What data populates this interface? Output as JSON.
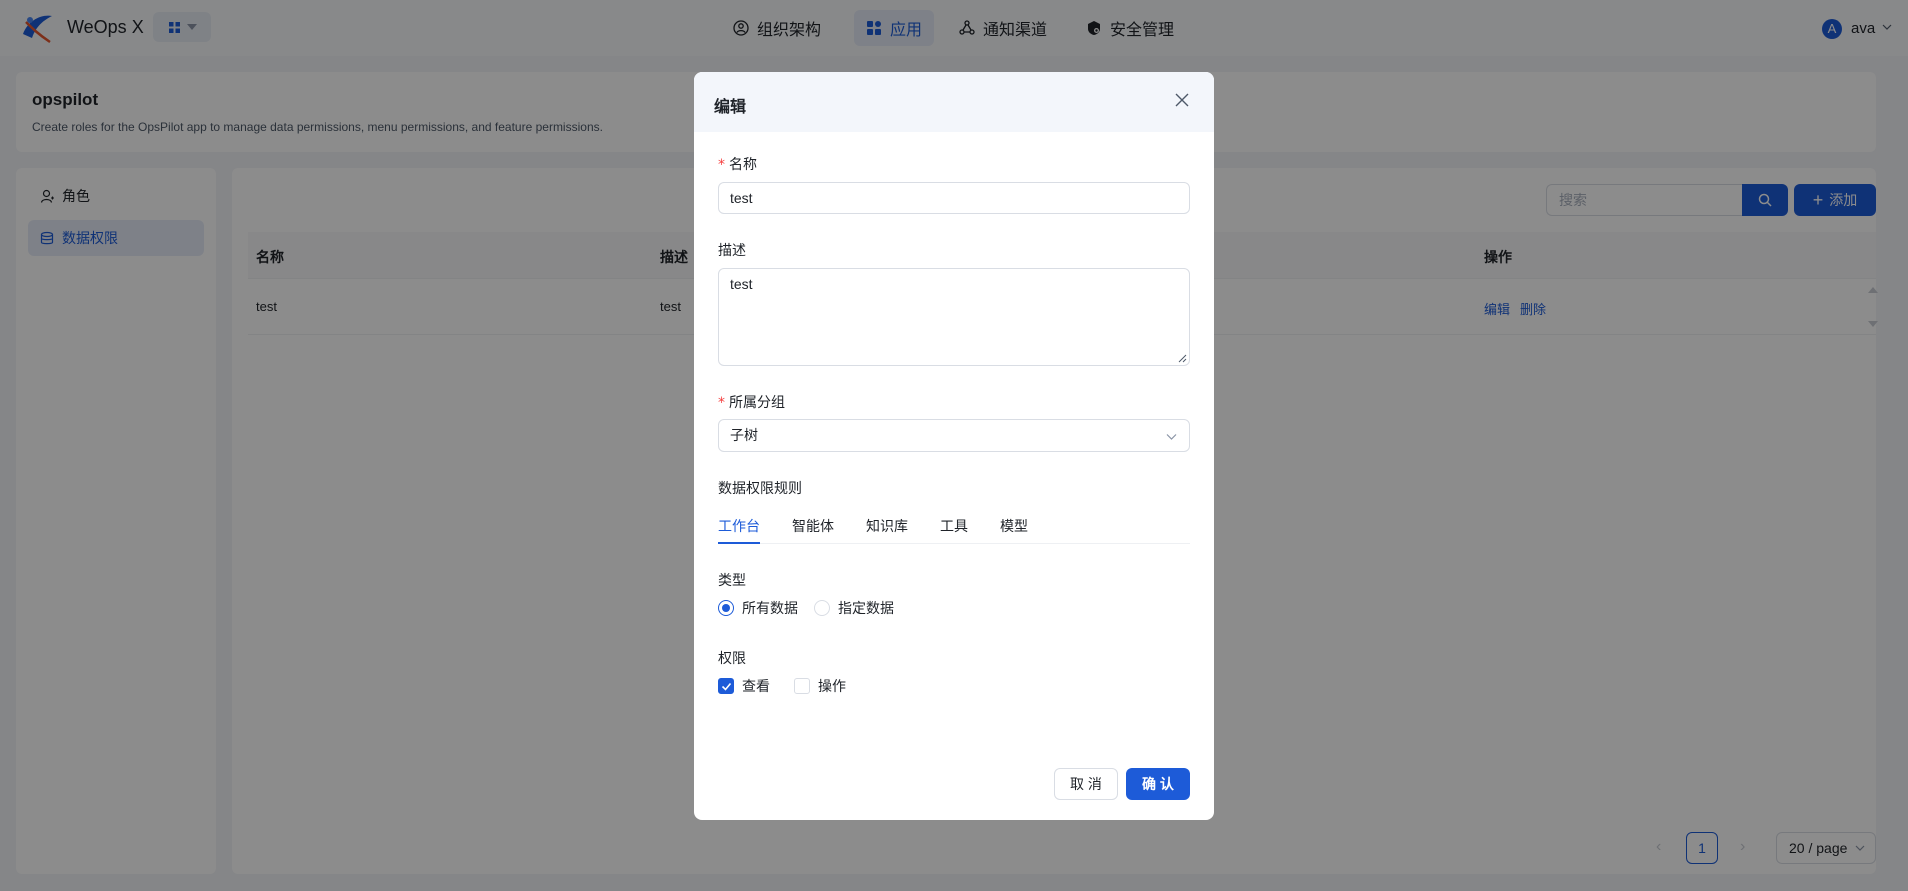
{
  "app": {
    "brand": "WeOps X",
    "logo_icon": "weops-logo-icon",
    "switcher_icon": "app-grid-icon",
    "accent_color": "#1d5bd8"
  },
  "nav": [
    {
      "label": "组织架构",
      "icon": "org-icon",
      "active": false
    },
    {
      "label": "应用",
      "icon": "app-icon",
      "active": true
    },
    {
      "label": "通知渠道",
      "icon": "notify-icon",
      "active": false
    },
    {
      "label": "安全管理",
      "icon": "security-icon",
      "active": false
    }
  ],
  "user": {
    "avatar_letter": "A",
    "name": "ava"
  },
  "header": {
    "title": "opspilot",
    "description": "Create roles for the OpsPilot app to manage data permissions, menu permissions, and feature permissions."
  },
  "sidebar": {
    "items": [
      {
        "label": "角色",
        "icon": "user-icon",
        "active": false
      },
      {
        "label": "数据权限",
        "icon": "database-icon",
        "active": true
      }
    ]
  },
  "toolbar": {
    "search_placeholder": "搜索",
    "add_label": "添加"
  },
  "table": {
    "columns": [
      "名称",
      "描述",
      "操作"
    ],
    "rows": [
      {
        "name": "test",
        "description": "test",
        "actions": [
          "编辑",
          "删除"
        ]
      }
    ]
  },
  "pagination": {
    "current_page": "1",
    "page_size": "20 / page"
  },
  "modal": {
    "title": "编辑",
    "fields": {
      "name": {
        "label": "名称",
        "required": true,
        "value": "test"
      },
      "description": {
        "label": "描述",
        "required": false,
        "value": "test"
      },
      "group": {
        "label": "所属分组",
        "required": true,
        "value": "子树"
      }
    },
    "rules_label": "数据权限规则",
    "tabs": [
      {
        "label": "工作台",
        "active": true
      },
      {
        "label": "智能体",
        "active": false
      },
      {
        "label": "知识库",
        "active": false
      },
      {
        "label": "工具",
        "active": false
      },
      {
        "label": "模型",
        "active": false
      }
    ],
    "type": {
      "label": "类型",
      "options": [
        {
          "label": "所有数据",
          "selected": true
        },
        {
          "label": "指定数据",
          "selected": false
        }
      ]
    },
    "permission": {
      "label": "权限",
      "options": [
        {
          "label": "查看",
          "checked": true
        },
        {
          "label": "操作",
          "checked": false
        }
      ]
    },
    "cancel_label": "取 消",
    "confirm_label": "确 认"
  }
}
